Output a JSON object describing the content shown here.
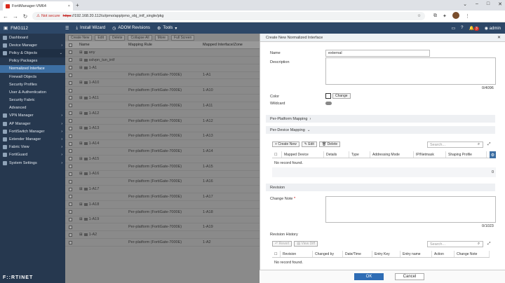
{
  "browser": {
    "tab_title": "FortiManager-VM64",
    "not_secure": "Not secure",
    "url_scheme": "https",
    "url_rest": "://192.168.20.112/ui/pmo/app/pmo_obj_intf_single/pkg",
    "notif_count": "3",
    "user": "admin"
  },
  "app": {
    "device": "FMG112",
    "install_wizard": "Install Wizard",
    "adom_revisions": "ADOM Revisions",
    "tools": "Tools"
  },
  "sidebar": {
    "items": [
      {
        "label": "Dashboard",
        "type": "top"
      },
      {
        "label": "Device Manager",
        "type": "top",
        "chev": ">"
      },
      {
        "label": "Policy & Objects",
        "type": "section",
        "chev": "v"
      },
      {
        "label": "Policy Packages",
        "type": "sub"
      },
      {
        "label": "Normalized Interface",
        "type": "active"
      },
      {
        "label": "Firewall Objects",
        "type": "sub"
      },
      {
        "label": "Security Profiles",
        "type": "sub"
      },
      {
        "label": "User & Authentication",
        "type": "sub"
      },
      {
        "label": "Security Fabric",
        "type": "sub"
      },
      {
        "label": "Advanced",
        "type": "sub"
      },
      {
        "label": "VPN Manager",
        "type": "top",
        "chev": ">"
      },
      {
        "label": "AP Manager",
        "type": "top",
        "chev": ">"
      },
      {
        "label": "FortiSwitch Manager",
        "type": "top",
        "chev": ">"
      },
      {
        "label": "Extender Manager",
        "type": "top",
        "chev": ">"
      },
      {
        "label": "Fabric View",
        "type": "top",
        "chev": ">"
      },
      {
        "label": "FortiGuard",
        "type": "top",
        "chev": ">"
      },
      {
        "label": "System Settings",
        "type": "top",
        "chev": ">"
      }
    ],
    "logo": "F::RTINET"
  },
  "main": {
    "toolbar": [
      "Create New",
      "Edit",
      "Delete",
      "Collapse All",
      "More",
      "Full Screen"
    ],
    "columns": [
      "Name",
      "Mapping Rule",
      "Mapped Interface/Zone"
    ],
    "rows": [
      {
        "name": "any",
        "rule": "",
        "mapped": ""
      },
      {
        "name": "sslvpn_tun_intf",
        "rule": "",
        "mapped": ""
      },
      {
        "name": "1-A1",
        "rule": "",
        "mapped": ""
      },
      {
        "name": "",
        "rule": "Per-platform (FortiGate-7000E)",
        "mapped": "1-A1"
      },
      {
        "name": "1-A10",
        "rule": "",
        "mapped": ""
      },
      {
        "name": "",
        "rule": "Per-platform (FortiGate-7000E)",
        "mapped": "1-A10"
      },
      {
        "name": "1-A11",
        "rule": "",
        "mapped": ""
      },
      {
        "name": "",
        "rule": "Per-platform (FortiGate-7000E)",
        "mapped": "1-A11"
      },
      {
        "name": "1-A12",
        "rule": "",
        "mapped": ""
      },
      {
        "name": "",
        "rule": "Per-platform (FortiGate-7000E)",
        "mapped": "1-A12"
      },
      {
        "name": "1-A13",
        "rule": "",
        "mapped": ""
      },
      {
        "name": "",
        "rule": "Per-platform (FortiGate-7000E)",
        "mapped": "1-A13"
      },
      {
        "name": "1-A14",
        "rule": "",
        "mapped": ""
      },
      {
        "name": "",
        "rule": "Per-platform (FortiGate-7000E)",
        "mapped": "1-A14"
      },
      {
        "name": "1-A15",
        "rule": "",
        "mapped": ""
      },
      {
        "name": "",
        "rule": "Per-platform (FortiGate-7000E)",
        "mapped": "1-A15"
      },
      {
        "name": "1-A16",
        "rule": "",
        "mapped": ""
      },
      {
        "name": "",
        "rule": "Per-platform (FortiGate-7000E)",
        "mapped": "1-A16"
      },
      {
        "name": "1-A17",
        "rule": "",
        "mapped": ""
      },
      {
        "name": "",
        "rule": "Per-platform (FortiGate-7000E)",
        "mapped": "1-A17"
      },
      {
        "name": "1-A18",
        "rule": "",
        "mapped": ""
      },
      {
        "name": "",
        "rule": "Per-platform (FortiGate-7000E)",
        "mapped": "1-A18"
      },
      {
        "name": "1-A19",
        "rule": "",
        "mapped": ""
      },
      {
        "name": "",
        "rule": "Per-platform (FortiGate-7000E)",
        "mapped": "1-A19"
      },
      {
        "name": "1-A2",
        "rule": "",
        "mapped": ""
      },
      {
        "name": "",
        "rule": "Per-platform (FortiGate-7000E)",
        "mapped": "1-A2"
      }
    ]
  },
  "panel": {
    "title": "Create New Normalized Interface",
    "name_label": "Name",
    "name_value": "external",
    "desc_label": "Description",
    "desc_count": "0/4096",
    "color_label": "Color",
    "color_button": "Change",
    "wildcard_label": "Wildcard",
    "per_platform": "Per-Platform Mapping",
    "per_device": "Per-Device Mapping",
    "pd_toolbar": [
      "Create New",
      "Edit",
      "Delete"
    ],
    "search_placeholder": "Search...",
    "pd_columns": [
      "Mapped Device",
      "Details",
      "Type",
      "Addressing Mode",
      "IP/Netmask",
      "Shaping Profile"
    ],
    "no_record": "No record found.",
    "pd_count": "0",
    "revision": "Revision",
    "change_note": "Change Note",
    "change_count": "0/1023",
    "rev_history": "Revision History",
    "rh_toolbar": [
      "Revert",
      "View Diff"
    ],
    "rh_columns": [
      "Revision",
      "Changed by",
      "Date/Time",
      "Entry Key",
      "Entry name",
      "Action",
      "Change Note"
    ],
    "ok": "OK",
    "cancel": "Cancel"
  },
  "colors": {
    "topbar": "#2d4767",
    "sidebar": "#26384f",
    "active": "#3d6fa3",
    "ok": "#2f6db5"
  }
}
